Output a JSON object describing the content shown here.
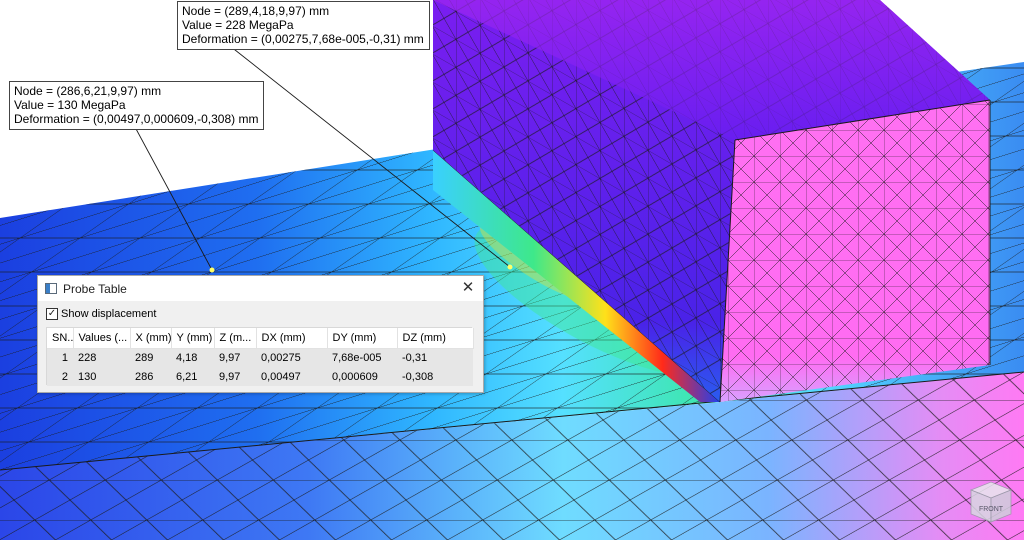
{
  "colors": {
    "mesh_line": "#1a1a1a",
    "deep_blue": "#1b3fe0",
    "cyan": "#55d8ff",
    "green": "#3fe08a",
    "yellow": "#ffe11a",
    "red": "#ff2a1a",
    "purple": "#7a1ef0",
    "magenta": "#ff6cf2"
  },
  "callouts": [
    {
      "node": "Node = (289,4,18,9,97) mm",
      "value": "Value = 228 MegaPa",
      "deformation": "Deformation = (0,00275,7,68e-005,-0,31) mm"
    },
    {
      "node": "Node = (286,6,21,9,97) mm",
      "value": "Value = 130 MegaPa",
      "deformation": "Deformation = (0,00497,0,000609,-0,308) mm"
    }
  ],
  "probe_table": {
    "title": "Probe Table",
    "title_icon": "window-icon",
    "close_glyph": "✕",
    "show_displacement_label": "Show displacement",
    "show_displacement_checked": true,
    "columns": [
      "SN...",
      "Values (...",
      "X (mm)",
      "Y (mm)",
      "Z (m...",
      "DX (mm)",
      "DY (mm)",
      "DZ (mm)"
    ],
    "rows": [
      {
        "sn": "1",
        "values": "228",
        "x": "289",
        "y": "4,18",
        "z": "9,97",
        "dx": "0,00275",
        "dy": "7,68e-005",
        "dz": "-0,31"
      },
      {
        "sn": "2",
        "values": "130",
        "x": "286",
        "y": "6,21",
        "z": "9,97",
        "dx": "0,00497",
        "dy": "0,000609",
        "dz": "-0,308"
      }
    ]
  },
  "view_cube": {
    "label": "FRONT",
    "icon": "view-cube-icon"
  }
}
